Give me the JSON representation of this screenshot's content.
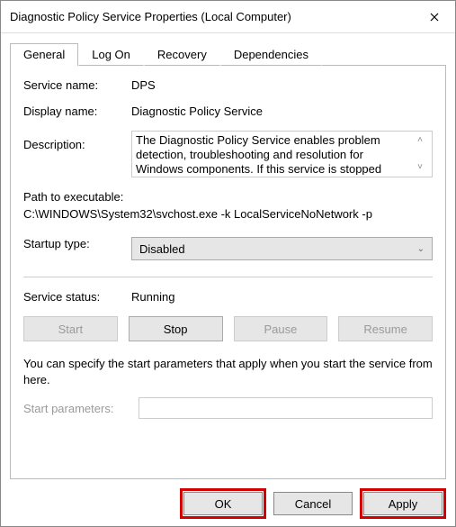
{
  "window": {
    "title": "Diagnostic Policy Service Properties (Local Computer)"
  },
  "tabs": {
    "general": "General",
    "logon": "Log On",
    "recovery": "Recovery",
    "dependencies": "Dependencies"
  },
  "fields": {
    "service_name_label": "Service name:",
    "service_name_value": "DPS",
    "display_name_label": "Display name:",
    "display_name_value": "Diagnostic Policy Service",
    "description_label": "Description:",
    "description_value": "The Diagnostic Policy Service enables problem detection, troubleshooting and resolution for Windows components. If this service is stopped",
    "path_label": "Path to executable:",
    "path_value": "C:\\WINDOWS\\System32\\svchost.exe -k LocalServiceNoNetwork -p",
    "startup_type_label": "Startup type:",
    "startup_type_value": "Disabled",
    "service_status_label": "Service status:",
    "service_status_value": "Running",
    "params_note": "You can specify the start parameters that apply when you start the service from here.",
    "start_params_label": "Start parameters:",
    "start_params_value": ""
  },
  "service_buttons": {
    "start": "Start",
    "stop": "Stop",
    "pause": "Pause",
    "resume": "Resume"
  },
  "dialog_buttons": {
    "ok": "OK",
    "cancel": "Cancel",
    "apply": "Apply"
  },
  "highlight": {
    "ok": true,
    "apply": true
  }
}
